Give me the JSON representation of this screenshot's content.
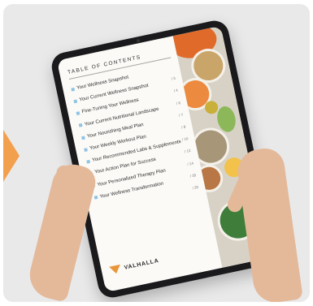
{
  "toc": {
    "title": "TABLE OF CONTENTS",
    "items": [
      {
        "label": "Your Wellness Snapshot",
        "page": ""
      },
      {
        "label": "Your Current Wellness Snapshot",
        "page": "/ 3"
      },
      {
        "label": "Fine-Tuning Your Wellness",
        "page": "/ 4"
      },
      {
        "label": "Your Current Nutritional Landscape",
        "page": "/ 6"
      },
      {
        "label": "Your Nourishing Meal Plan",
        "page": "/ 7"
      },
      {
        "label": "Your Weekly Workout Plan",
        "page": "/ 8"
      },
      {
        "label": "Your Recommended Labs & Supplements",
        "page": "/ 10"
      },
      {
        "label": "Your Action Plan for Success",
        "page": "/ 12"
      },
      {
        "label": "Your Personalized Therapy Plan",
        "page": "/ 14"
      },
      {
        "label": "Your Wellness Transformation",
        "page": "/ 18"
      },
      {
        "label": "",
        "page": "/ 20"
      }
    ]
  },
  "brand": {
    "name": "VALHALLA",
    "accent_color": "#f2a04d"
  }
}
